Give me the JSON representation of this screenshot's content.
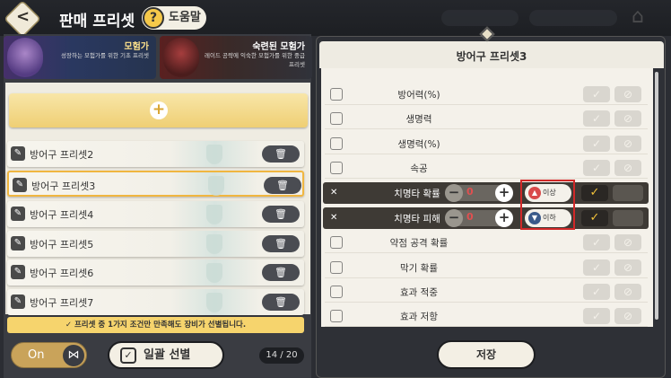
{
  "header": {
    "back_icon": "back-arrow-icon",
    "title": "판매 프리셋",
    "help_label": "도움말",
    "help_icon": "?"
  },
  "advisors": [
    {
      "title": "모험가",
      "desc": "성장하는 모험가를 위한 기초 프리셋"
    },
    {
      "title": "숙련된 모험가",
      "desc": "레이드 공략에 익숙한 모험가를 위한 중급 프리셋"
    }
  ],
  "presets": [
    {
      "label": "방어구 프리셋2"
    },
    {
      "label": "방어구 프리셋3"
    },
    {
      "label": "방어구 프리셋4"
    },
    {
      "label": "방어구 프리셋5"
    },
    {
      "label": "방어구 프리셋6"
    },
    {
      "label": "방어구 프리셋7"
    }
  ],
  "selected_preset": "방어구 프리셋3",
  "notice": "프리셋 중 1가지 조건만 만족해도 장비가 선별됩니다.",
  "toggle_label": "On",
  "bulk_select_label": "일괄 선별",
  "count": "14 / 20",
  "detail": {
    "title": "방어구 프리셋3",
    "stats": [
      {
        "label": "방어력(%)"
      },
      {
        "label": "생명력"
      },
      {
        "label": "생명력(%)"
      },
      {
        "label": "속공"
      },
      {
        "label": "치명타 확률",
        "active": true,
        "value": "0",
        "condition": "이상"
      },
      {
        "label": "치명타 피해",
        "active": true,
        "value": "0",
        "condition": "이하"
      },
      {
        "label": "약점 공격 확률"
      },
      {
        "label": "막기 확률"
      },
      {
        "label": "효과 적중"
      },
      {
        "label": "효과 저항"
      }
    ],
    "save_label": "저장"
  },
  "colors": {
    "accent": "#f0b640",
    "highlight_box": "#d02828",
    "up": "#d94a4a",
    "down": "#3a5a8a"
  }
}
